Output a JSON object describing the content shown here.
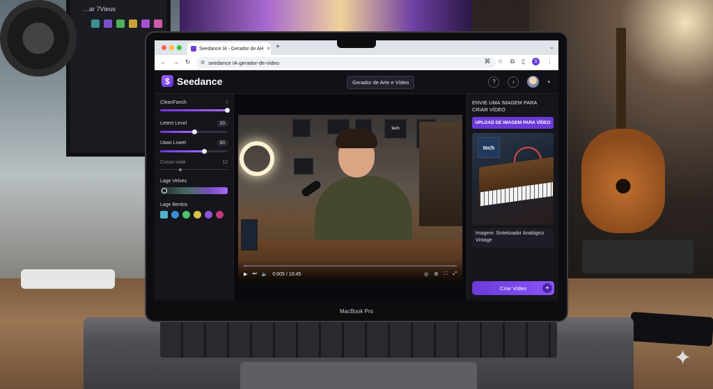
{
  "background": {
    "monitor_title": "…ar 7Vieus",
    "monitor_swatches": [
      "#3a8f8f",
      "#7a52c8",
      "#4fb05a",
      "#c7a23a",
      "#a74fd0",
      "#d05aa8"
    ],
    "laptop_label": "MacBook Pro"
  },
  "browser": {
    "tab_title": "Seedance IA - Gerador de AH",
    "new_tab": "+",
    "url": "seedance IA-gerador-de-vídeo",
    "icons": [
      "back-icon",
      "forward-icon",
      "reload-icon",
      "translate-icon",
      "star-icon",
      "extensions-icon",
      "sidebar-icon",
      "menu-icon"
    ],
    "profile_initial": "S"
  },
  "app": {
    "brand": "Seedance",
    "logo_glyph": "$",
    "center_button": "Gerador de Arte e Vídeo",
    "help_glyph": "?",
    "bell_glyph": "🔔"
  },
  "left_panel": {
    "model_label": "CleanFanch",
    "model_menu_glyph": "⁝",
    "model_slider": 0.99,
    "latent_level_label": "Letent Level",
    "latent_level_value": "20",
    "latent_level_slider": 0.5,
    "usage_level_label": "Uaao Lowel",
    "usage_level_value": "50",
    "usage_level_slider": 0.65,
    "cusso_label": "Cusso viota",
    "cusso_value": "12",
    "cusso_slider": 0.3,
    "velves_label": "Lage Velves",
    "bentos_label": "Lage Bentos",
    "bentos_colors": [
      "#4fb3c8",
      "#3a8fd8",
      "#4fc26a",
      "#d8c24a",
      "#8a55d8",
      "#c23a7a"
    ]
  },
  "video": {
    "time": "0:005 / 10:45",
    "progress": 0.01,
    "accent": "#8b55ff",
    "screen_tech_label": "tech"
  },
  "right_panel": {
    "title": "ENVIE UMA !MAGEM PARA CRIAR VÍDEO",
    "upload_button": "UPLOAD DE IMAGEM PARA VÍDEO",
    "thumb_label": "tech",
    "caption": "Imagem: Sintetizador Analógico Vintage",
    "create_button": "Criar Vídeo",
    "accent": "#6a3ad6"
  }
}
